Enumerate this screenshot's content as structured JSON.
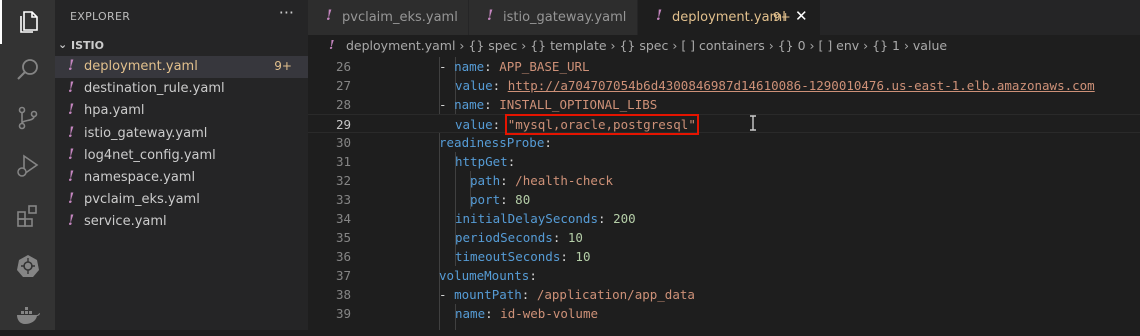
{
  "explorer": {
    "title": "EXPLORER",
    "more_label": "···",
    "folder": "ISTIO",
    "files": [
      {
        "name": "deployment.yaml",
        "badge": "9+",
        "active": true
      },
      {
        "name": "destination_rule.yaml"
      },
      {
        "name": "hpa.yaml"
      },
      {
        "name": "istio_gateway.yaml"
      },
      {
        "name": "log4net_config.yaml"
      },
      {
        "name": "namespace.yaml"
      },
      {
        "name": "pvclaim_eks.yaml"
      },
      {
        "name": "service.yaml"
      }
    ]
  },
  "tabs": [
    {
      "label": "pvclaim_eks.yaml"
    },
    {
      "label": "istio_gateway.yaml"
    },
    {
      "label": "deployment.yaml",
      "badge": "9+",
      "close": "✕",
      "active": true
    }
  ],
  "breadcrumb": "deployment.yaml › {} spec › {} template › {} spec › [ ] containers › {} 0 › [ ] env › {} 1 › value",
  "breadcrumb_icon_text": "abc",
  "editor": {
    "lines": [
      {
        "num": "26"
      },
      {
        "num": "27"
      },
      {
        "num": "28"
      },
      {
        "num": "29"
      },
      {
        "num": "30"
      },
      {
        "num": "31"
      },
      {
        "num": "32"
      },
      {
        "num": "33"
      },
      {
        "num": "34"
      },
      {
        "num": "35"
      },
      {
        "num": "36"
      },
      {
        "num": "37"
      },
      {
        "num": "38"
      },
      {
        "num": "39"
      }
    ],
    "code": {
      "l26_key": "name",
      "l26_val": "APP_BASE_URL",
      "l27_key": "value",
      "l27_val": "http://a704707054b6d4300846987d14610086-1290010476.us-east-1.elb.amazonaws.com",
      "l28_key": "name",
      "l28_val": "INSTALL_OPTIONAL_LIBS",
      "l29_key": "value",
      "l29_val": "\"mysql,oracle,postgresql\"",
      "l30_key": "readinessProbe",
      "l31_key": "httpGet",
      "l32_key": "path",
      "l32_val": "/health-check",
      "l33_key": "port",
      "l33_val": "80",
      "l34_key": "initialDelaySeconds",
      "l34_val": "200",
      "l35_key": "periodSeconds",
      "l35_val": "10",
      "l36_key": "timeoutSeconds",
      "l36_val": "10",
      "l37_key": "volumeMounts",
      "l38_key": "mountPath",
      "l38_val": "/application/app_data",
      "l39_key": "name",
      "l39_val": "id-web-volume"
    }
  },
  "colors": {
    "accent_modified": "#e2c08d",
    "yaml_icon": "#c586c0",
    "highlight_box": "#e51400"
  }
}
